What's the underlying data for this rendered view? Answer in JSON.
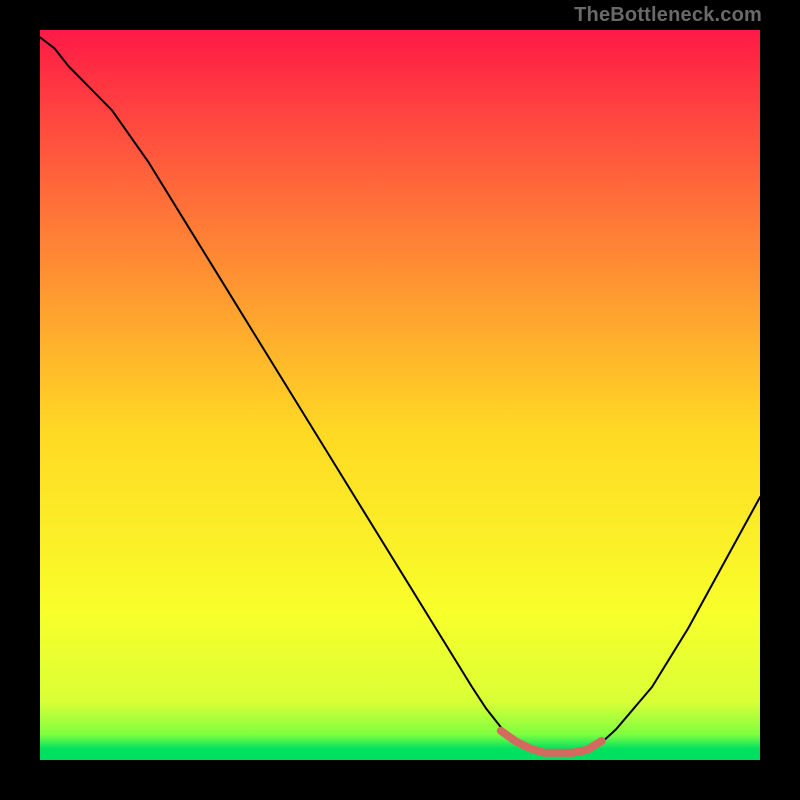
{
  "watermark": "TheBottleneck.com",
  "chart_data": {
    "type": "line",
    "title": "",
    "xlabel": "",
    "ylabel": "",
    "xlim": [
      0,
      100
    ],
    "ylim": [
      0,
      100
    ],
    "background_gradient": {
      "top": "#ff1a46",
      "mid_top": "#ff6a3a",
      "mid": "#ffd924",
      "mid_low": "#f8ff2a",
      "low": "#d9ff36",
      "bottom": "#00e060"
    },
    "series": [
      {
        "name": "bottleneck-curve",
        "color": "#000000",
        "stroke_width": 2,
        "x": [
          0,
          2,
          4,
          6,
          8,
          10,
          15,
          20,
          25,
          30,
          35,
          40,
          45,
          50,
          55,
          60,
          62,
          64,
          66,
          68,
          70,
          72,
          74,
          76,
          78,
          80,
          85,
          90,
          95,
          100
        ],
        "y": [
          99,
          97.5,
          95,
          93,
          91,
          89,
          82,
          74,
          66,
          58,
          50,
          42,
          34,
          26,
          18,
          10,
          7,
          4.5,
          2.8,
          1.6,
          1.0,
          1.0,
          1.0,
          1.4,
          2.4,
          4.2,
          10,
          18,
          27,
          36
        ]
      },
      {
        "name": "optimal-range-marker",
        "color": "#d46a5e",
        "stroke_width": 8,
        "x": [
          64,
          66,
          68,
          70,
          72,
          74,
          76,
          78
        ],
        "y": [
          4.0,
          2.6,
          1.6,
          1.0,
          1.0,
          1.0,
          1.4,
          2.6
        ]
      }
    ],
    "optimal_range": {
      "x_min": 64,
      "x_max": 78
    }
  }
}
